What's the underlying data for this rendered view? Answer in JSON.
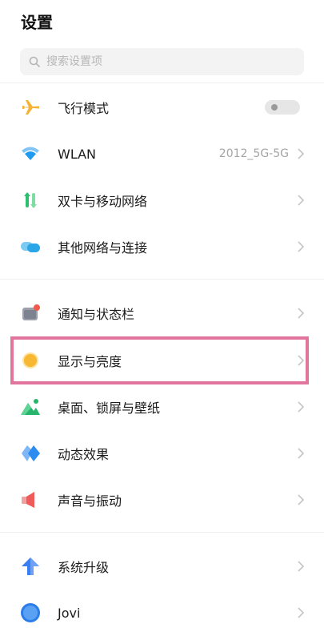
{
  "header": {
    "title": "设置"
  },
  "search": {
    "placeholder": "搜索设置项"
  },
  "items": [
    {
      "label": "飞行模式",
      "icon": "airplane-icon",
      "toggle": "off"
    },
    {
      "label": "WLAN",
      "icon": "wifi-icon",
      "value": "2012_5G-5G"
    },
    {
      "label": "双卡与移动网络",
      "icon": "dual-sim-icon"
    },
    {
      "label": "其他网络与连接",
      "icon": "network-connection-icon"
    },
    {
      "label": "通知与状态栏",
      "icon": "notification-icon"
    },
    {
      "label": "显示与亮度",
      "icon": "brightness-icon",
      "highlighted": true
    },
    {
      "label": "桌面、锁屏与壁纸",
      "icon": "wallpaper-icon"
    },
    {
      "label": "动态效果",
      "icon": "dynamic-effects-icon"
    },
    {
      "label": "声音与振动",
      "icon": "sound-icon"
    },
    {
      "label": "系统升级",
      "icon": "system-update-icon"
    },
    {
      "label": "Jovi",
      "icon": "jovi-icon"
    }
  ],
  "colors": {
    "accent_highlight": "#e2759d",
    "airplane": "#f5b335",
    "wifi": "#1e9bf0",
    "dual_sim": "#2fbf71",
    "network": "#2aa6e8",
    "notification": "#7d8290",
    "brightness": "#f7b733",
    "wallpaper": "#27b56b",
    "dynamic": "#2d8cf0",
    "sound": "#ef5a5a",
    "update": "#3a7ff2",
    "jovi": "#2b7de9"
  }
}
